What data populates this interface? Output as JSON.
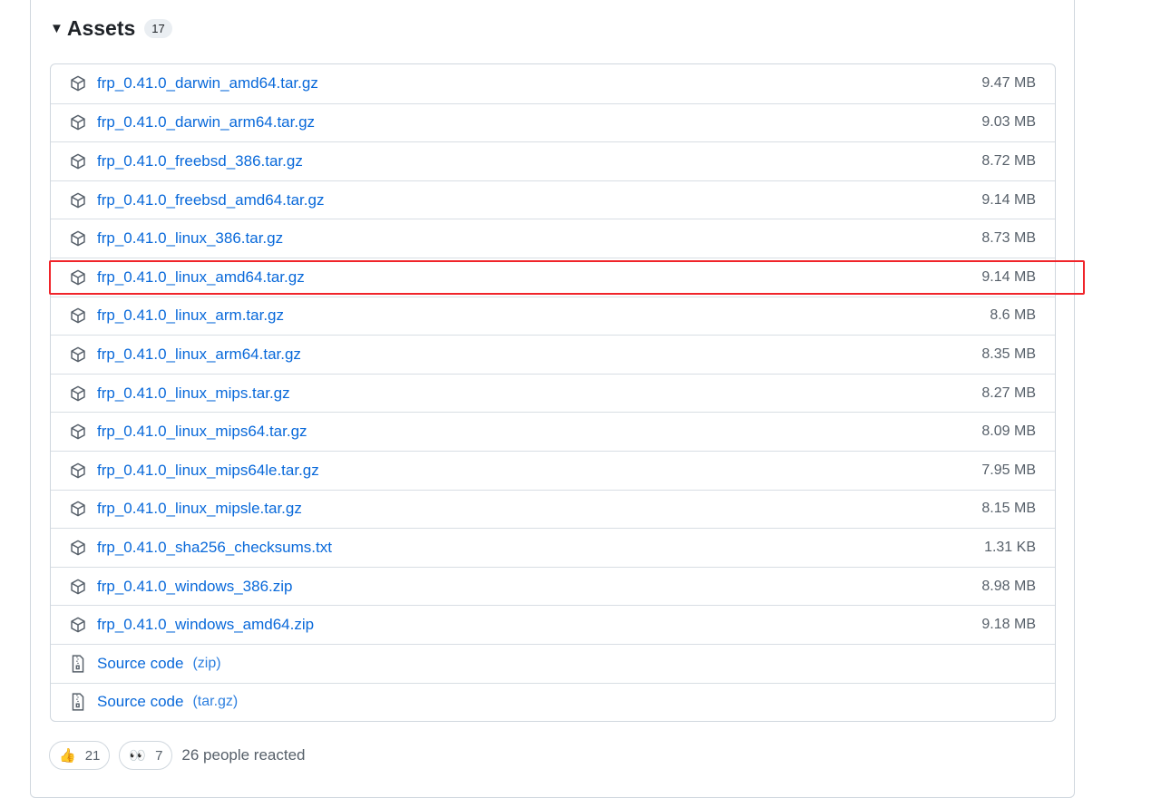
{
  "assets": {
    "title": "Assets",
    "count": "17",
    "files": [
      {
        "name": "frp_0.41.0_darwin_amd64.tar.gz",
        "size": "9.47 MB"
      },
      {
        "name": "frp_0.41.0_darwin_arm64.tar.gz",
        "size": "9.03 MB"
      },
      {
        "name": "frp_0.41.0_freebsd_386.tar.gz",
        "size": "8.72 MB"
      },
      {
        "name": "frp_0.41.0_freebsd_amd64.tar.gz",
        "size": "9.14 MB"
      },
      {
        "name": "frp_0.41.0_linux_386.tar.gz",
        "size": "8.73 MB"
      },
      {
        "name": "frp_0.41.0_linux_amd64.tar.gz",
        "size": "9.14 MB"
      },
      {
        "name": "frp_0.41.0_linux_arm.tar.gz",
        "size": "8.6 MB"
      },
      {
        "name": "frp_0.41.0_linux_arm64.tar.gz",
        "size": "8.35 MB"
      },
      {
        "name": "frp_0.41.0_linux_mips.tar.gz",
        "size": "8.27 MB"
      },
      {
        "name": "frp_0.41.0_linux_mips64.tar.gz",
        "size": "8.09 MB"
      },
      {
        "name": "frp_0.41.0_linux_mips64le.tar.gz",
        "size": "7.95 MB"
      },
      {
        "name": "frp_0.41.0_linux_mipsle.tar.gz",
        "size": "8.15 MB"
      },
      {
        "name": "frp_0.41.0_sha256_checksums.txt",
        "size": "1.31 KB"
      },
      {
        "name": "frp_0.41.0_windows_386.zip",
        "size": "8.98 MB"
      },
      {
        "name": "frp_0.41.0_windows_amd64.zip",
        "size": "9.18 MB"
      }
    ],
    "source": [
      {
        "name": "Source code",
        "ext": "(zip)"
      },
      {
        "name": "Source code",
        "ext": "(tar.gz)"
      }
    ],
    "highlighted_index": 5,
    "highlight_color": "#f0242a"
  },
  "reactions": {
    "thumbs_up": "21",
    "eyes": "7",
    "summary": "26 people reacted"
  }
}
